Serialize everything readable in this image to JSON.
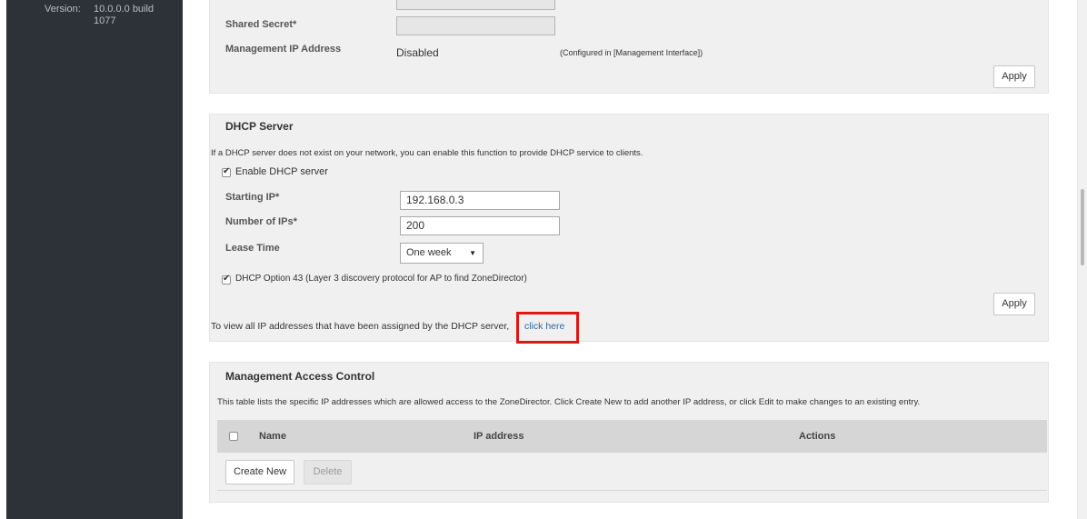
{
  "sidebar": {
    "version_label": "Version:",
    "version_value": "10.0.0.0 build 1077"
  },
  "radius_panel": {
    "shared_secret_label": "Shared Secret*",
    "shared_secret_value": "",
    "mgmt_ip_label": "Management IP Address",
    "mgmt_ip_value": "Disabled",
    "mgmt_ip_note": "(Configured in [Management Interface])",
    "apply_label": "Apply"
  },
  "dhcp": {
    "title": "DHCP Server",
    "description": "If a DHCP server does not exist on your network, you can enable this function to provide DHCP service to clients.",
    "enable_label": "Enable DHCP server",
    "enable_checked": true,
    "starting_ip_label": "Starting IP*",
    "starting_ip_value": "192.168.0.3",
    "num_ips_label": "Number of IPs*",
    "num_ips_value": "200",
    "lease_time_label": "Lease Time",
    "lease_time_value": "One week",
    "option43_label": "DHCP Option 43   (Layer 3 discovery protocol for AP to find ZoneDirector)",
    "option43_checked": true,
    "apply_label": "Apply",
    "view_text": "To view all IP addresses that have been assigned by the DHCP server,",
    "click_here": "click here"
  },
  "mac": {
    "title": "Management Access Control",
    "description": "This table lists the specific IP addresses which are allowed access to the ZoneDirector. Click Create New to add another IP address, or click Edit to make changes to an existing entry.",
    "columns": [
      "Name",
      "IP address",
      "Actions"
    ],
    "create_label": "Create New",
    "delete_label": "Delete"
  },
  "colors": {
    "sidebar_bg": "#2d3238",
    "panel_bg": "#f0f0f0",
    "link": "#2b6aa3",
    "highlight": "#e01515"
  }
}
